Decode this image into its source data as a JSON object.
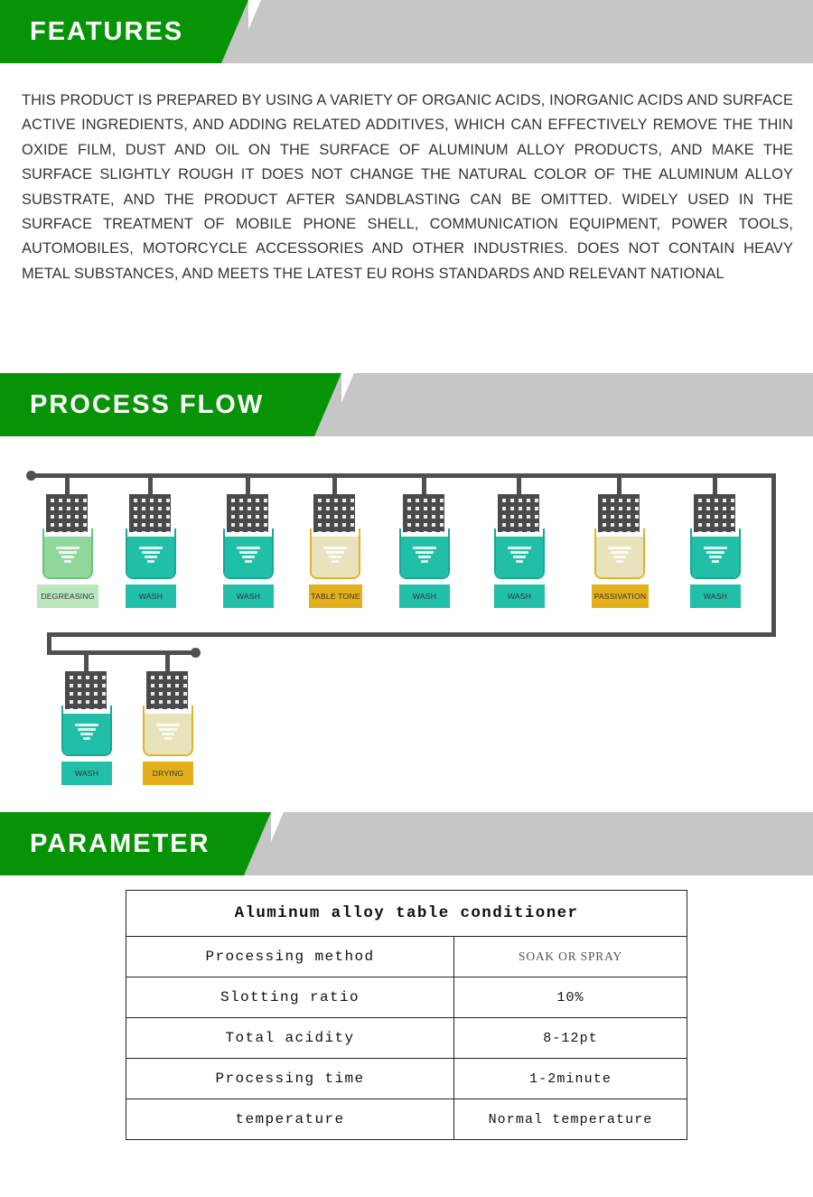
{
  "sections": {
    "features": {
      "title": "FEATURES",
      "body": "THIS PRODUCT IS PREPARED BY USING A VARIETY OF ORGANIC ACIDS, INORGANIC ACIDS AND SURFACE ACTIVE INGREDIENTS, AND ADDING RELATED ADDITIVES, WHICH CAN EFFECTIVELY REMOVE THE THIN OXIDE FILM, DUST AND OIL ON THE SURFACE OF ALUMINUM ALLOY PRODUCTS, AND MAKE THE SURFACE SLIGHTLY ROUGH IT DOES NOT CHANGE THE NATURAL COLOR OF THE ALUMINUM ALLOY SUBSTRATE, AND THE PRODUCT AFTER SANDBLASTING CAN BE OMITTED. WIDELY USED IN THE SURFACE TREATMENT OF MOBILE PHONE SHELL, COMMUNICATION EQUIPMENT, POWER TOOLS, AUTOMOBILES, MOTORCYCLE ACCESSORIES AND OTHER INDUSTRIES. DOES NOT CONTAIN HEAVY METAL SUBSTANCES, AND MEETS THE LATEST EU ROHS STANDARDS AND RELEVANT NATIONAL"
    },
    "process_flow": {
      "title": "PROCESS FLOW",
      "steps_row1": [
        {
          "label": "DEGREASING",
          "tank_color": "#91d79b",
          "tank_border": "#6bc47c",
          "tag_color": "#b9e5bf"
        },
        {
          "label": "WASH",
          "tank_color": "#21bfa8",
          "tank_border": "#18a894",
          "tag_color": "#21bfa8"
        },
        {
          "label": "WASH",
          "tank_color": "#21bfa8",
          "tank_border": "#18a894",
          "tag_color": "#21bfa8"
        },
        {
          "label": "TABLE TONE",
          "tank_color": "#e8e3bd",
          "tank_border": "#e3b324",
          "tag_color": "#e3b01c"
        },
        {
          "label": "WASH",
          "tank_color": "#21bfa8",
          "tank_border": "#18a894",
          "tag_color": "#21bfa8"
        },
        {
          "label": "WASH",
          "tank_color": "#21bfa8",
          "tank_border": "#18a894",
          "tag_color": "#21bfa8"
        },
        {
          "label": "PASSIVATION",
          "tank_color": "#e8e3bd",
          "tank_border": "#e3b324",
          "tag_color": "#e3b01c"
        },
        {
          "label": "WASH",
          "tank_color": "#21bfa8",
          "tank_border": "#18a894",
          "tag_color": "#21bfa8"
        }
      ],
      "steps_row2": [
        {
          "label": "WASH",
          "tank_color": "#21bfa8",
          "tank_border": "#18a894",
          "tag_color": "#21bfa8"
        },
        {
          "label": "DRYING",
          "tank_color": "#e8e3bd",
          "tank_border": "#e3b324",
          "tag_color": "#e3b01c"
        }
      ]
    },
    "parameter": {
      "title": "PARAMETER",
      "table": {
        "caption": "Aluminum alloy table conditioner",
        "rows": [
          {
            "key": "Processing method",
            "value": "SOAK OR SPRAY"
          },
          {
            "key": "Slotting ratio",
            "value": "10%"
          },
          {
            "key": "Total acidity",
            "value": "8-12pt"
          },
          {
            "key": "Processing time",
            "value": "1-2minute"
          },
          {
            "key": "temperature",
            "value": "Normal temperature"
          }
        ]
      }
    }
  },
  "colors": {
    "brand_green": "#069406",
    "banner_gray": "#c6c6c6",
    "teal": "#21bfa8",
    "light_green": "#91d79b",
    "gold": "#e3b01c",
    "cream": "#e8e3bd",
    "rail": "#4f4f4f"
  }
}
